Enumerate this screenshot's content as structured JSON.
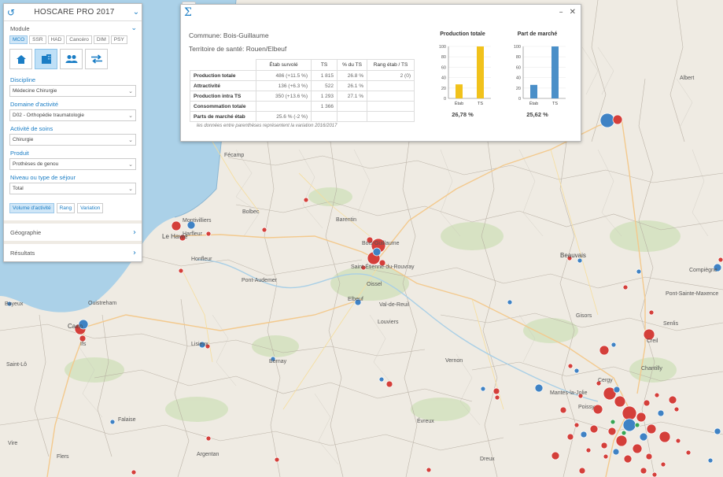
{
  "app": {
    "title": "HOSCARE PRO 2017"
  },
  "panel": {
    "module_label": "Module",
    "module_tabs": [
      "MCO",
      "SSR",
      "HAD",
      "Cancéro",
      "DIM",
      "PSY"
    ],
    "active_tab": "MCO",
    "icons": [
      "establishment-icon",
      "building-icon",
      "patients-icon",
      "transfer-icon"
    ],
    "fields": [
      {
        "label": "Discipline",
        "value": "Médecine Chirurgie"
      },
      {
        "label": "Domaine d'activité",
        "value": "D02 - Orthopédie traumatologie"
      },
      {
        "label": "Activité de soins",
        "value": "Chirurgie"
      },
      {
        "label": "Produit",
        "value": "Prothèses de genou"
      },
      {
        "label": "Niveau ou type de séjour",
        "value": "Total"
      }
    ],
    "view_buttons": [
      "Volume d'activité",
      "Rang",
      "Variation"
    ],
    "sections": [
      "Géographie",
      "Résultats"
    ]
  },
  "popup": {
    "commune": "Commune: Bois-Guillaume",
    "territoire": "Territoire de santé: Rouen/Elbeuf",
    "table": {
      "headers": [
        "",
        "Étab survolé",
        "TS",
        "% du TS",
        "Rang étab / TS"
      ],
      "rows": [
        [
          "Production totale",
          "486 (+11.5 %)",
          "1 815",
          "26.8 %",
          "2 (0)"
        ],
        [
          "Attractivité",
          "136 (+6.3 %)",
          "522",
          "26.1 %",
          ""
        ],
        [
          "Production intra TS",
          "350 (+13.6 %)",
          "1 293",
          "27.1 %",
          ""
        ],
        [
          "Consommation totale",
          "",
          "1 366",
          "",
          ""
        ],
        [
          "Parts de marché étab",
          "25.6 % (-2 %)",
          "",
          "",
          ""
        ]
      ]
    },
    "footnote": "les données entre parenthèses représentent la variation 2016/2017",
    "charts": [
      {
        "title": "Production totale",
        "pct": "26,78 %"
      },
      {
        "title": "Part de marché",
        "pct": "25,62 %"
      }
    ]
  },
  "chart_data": [
    {
      "type": "bar",
      "title": "Production totale",
      "categories": [
        "Étab",
        "TS"
      ],
      "values": [
        27,
        100
      ],
      "ylim": [
        0,
        100
      ],
      "yticks": [
        0,
        20,
        40,
        60,
        80,
        100
      ],
      "color": "#f1c21b"
    },
    {
      "type": "bar",
      "title": "Part de marché",
      "categories": [
        "Étab",
        "TS"
      ],
      "values": [
        26,
        100
      ],
      "ylim": [
        0,
        100
      ],
      "yticks": [
        0,
        20,
        40,
        60,
        80,
        100
      ],
      "color": "#4a8fc8"
    }
  ],
  "map": {
    "places": [
      "Fécamp",
      "Bolbec",
      "Harfleur",
      "Le Havre",
      "Montivilliers",
      "Honfleur",
      "Pont-Audemer",
      "Barentin",
      "Bois-Guillaume",
      "Saint-Étienne-du-Rouvray",
      "Oissel",
      "Elbeuf",
      "Louviers",
      "Val-de-Reuil",
      "Ouistreham",
      "Caen",
      "Ifs",
      "Bayeux",
      "Lisieux",
      "Bernay",
      "Vernon",
      "Beauvais",
      "Gisors",
      "Senlis",
      "Pont-Sainte-Maxence",
      "Albert",
      "Mantes-la-Jolie",
      "Poissy",
      "Cergy",
      "Évreux",
      "Dreux",
      "Falaise",
      "Argentan",
      "Flers",
      "Vire",
      "Saint-Lô",
      "Creil",
      "Compiègne",
      "Chantilly"
    ]
  }
}
